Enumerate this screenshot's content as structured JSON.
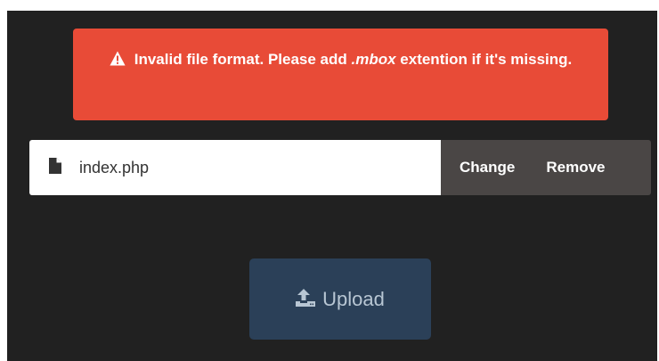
{
  "alert": {
    "message_before": "Invalid file format. Please add ",
    "message_emphasis": ".mbox",
    "message_after": " extention if it's missing.",
    "icon": "warning-icon",
    "background_color": "#e84b37"
  },
  "file": {
    "icon": "file-icon",
    "name": "index.php",
    "change_label": "Change",
    "remove_label": "Remove"
  },
  "upload": {
    "icon": "upload-icon",
    "label": "Upload",
    "background_color": "#2b4058"
  }
}
